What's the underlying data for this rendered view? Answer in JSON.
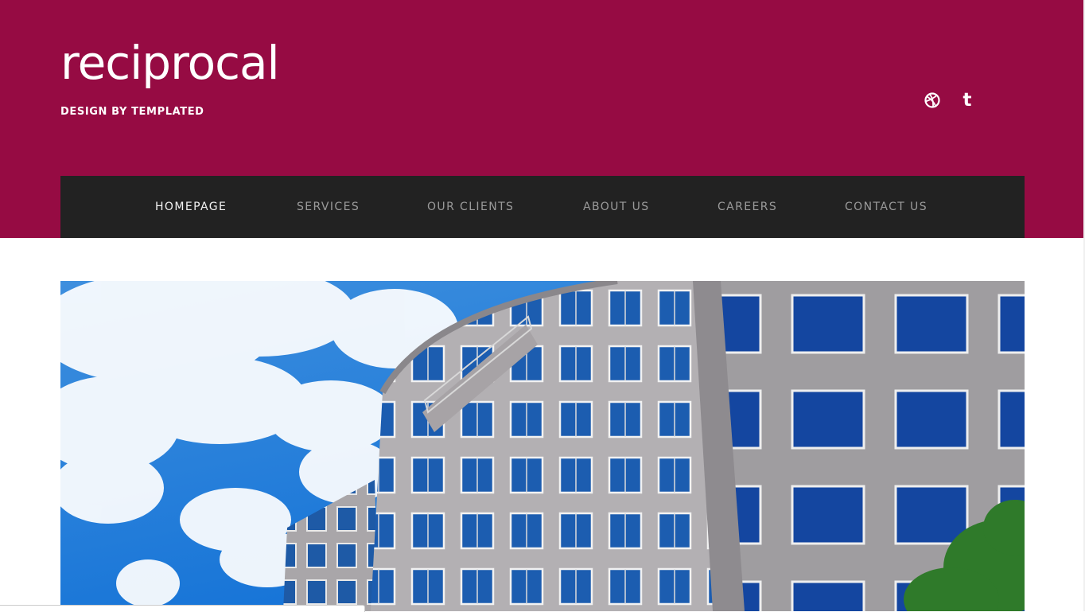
{
  "site": {
    "logo": "reciprocal",
    "tagline": "DESIGN BY TEMPLATED"
  },
  "social": [
    {
      "icon": "dribbble-icon"
    },
    {
      "icon": "tumblr-icon"
    }
  ],
  "nav": {
    "items": [
      {
        "label": "HOMEPAGE",
        "active": true
      },
      {
        "label": "SERVICES",
        "active": false
      },
      {
        "label": "OUR CLIENTS",
        "active": false
      },
      {
        "label": "ABOUT US",
        "active": false
      },
      {
        "label": "CAREERS",
        "active": false
      },
      {
        "label": "CONTACT US",
        "active": false
      }
    ]
  },
  "colors": {
    "header_bg": "#960b43",
    "nav_bg": "#222222",
    "nav_text": "#9a9a9a",
    "nav_active_text": "#f2f2f2"
  }
}
